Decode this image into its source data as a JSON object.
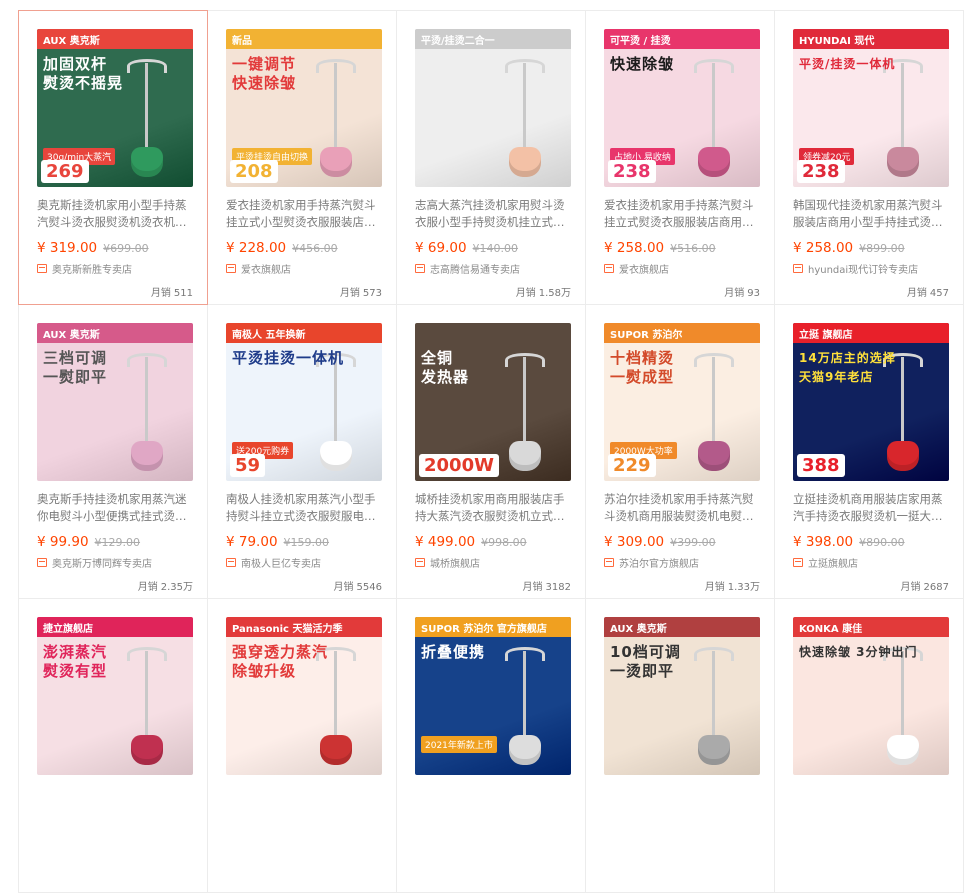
{
  "products": [
    {
      "image": {
        "banner": "AUX 奥克斯",
        "headline": "加固双杆\n熨烫不摇晃",
        "tag": "30g/min大蒸汽",
        "price_tag": "269",
        "bg": "#2f6b4f",
        "fg": "#ffffff",
        "accent": "#e8453c",
        "tank": "#2f9a5e"
      },
      "title": "奥克斯挂烫机家用小型手持蒸汽熨斗烫衣服熨烫机烫衣机电…",
      "price": "¥ 319.00",
      "original_price": "¥699.00",
      "shop": "奥克斯新胜专卖店",
      "sales_label": "月销",
      "sales": "511"
    },
    {
      "image": {
        "banner": "新品",
        "headline": "一键调节\n快速除皱",
        "tag": "平烫挂烫自由切换",
        "price_tag": "208",
        "bg": "#f4e3d6",
        "fg": "#e23a3a",
        "accent": "#f2b233",
        "tank": "#e9a0b8"
      },
      "title": "爱衣挂烫机家用手持蒸汽熨斗挂立式小型熨烫衣服服装店商…",
      "price": "¥ 228.00",
      "original_price": "¥456.00",
      "shop": "爱衣旗舰店",
      "sales_label": "月销",
      "sales": "573"
    },
    {
      "image": {
        "banner": "平烫/挂烫二合一",
        "headline": "",
        "tag": "",
        "price_tag": "",
        "bg": "#eeeeee",
        "fg": "#333333",
        "accent": "#cccccc",
        "tank": "#f3c1a6"
      },
      "title": "志高大蒸汽挂烫机家用熨斗烫衣服小型手持熨烫机挂立式电…",
      "price": "¥ 69.00",
      "original_price": "¥140.00",
      "shop": "志高腾信易通专卖店",
      "sales_label": "月销",
      "sales": "1.58万"
    },
    {
      "image": {
        "banner": "可平烫 / 挂烫",
        "headline": "快速除皱",
        "tag": "占地小 易收纳",
        "price_tag": "238",
        "bg": "#f6d9e2",
        "fg": "#1c1c1c",
        "accent": "#e8356b",
        "tank": "#d05a8c"
      },
      "title": "爱衣挂烫机家用手持蒸汽熨斗挂立式熨烫衣服服装店商用…",
      "price": "¥ 258.00",
      "original_price": "¥516.00",
      "shop": "爱衣旗舰店",
      "sales_label": "月销",
      "sales": "93"
    },
    {
      "image": {
        "banner": "HYUNDAI 现代",
        "headline": "平烫/挂烫一体机",
        "tag": "领券减20元",
        "price_tag": "238",
        "bg": "#fbe8ec",
        "fg": "#e02a3a",
        "accent": "#e02a3a",
        "tank": "#c9899d"
      },
      "title": "韩国现代挂烫机家用蒸汽熨斗服装店商用小型手持挂式烫衣…",
      "price": "¥ 258.00",
      "original_price": "¥899.00",
      "shop": "hyundai现代订铃专卖店",
      "sales_label": "月销",
      "sales": "457"
    },
    {
      "image": {
        "banner": "AUX 奥克斯",
        "headline": "三档可调\n一熨即平",
        "tag": "",
        "price_tag": "",
        "bg": "#f1d3df",
        "fg": "#555555",
        "accent": "#d65a8a",
        "tank": "#e0a7c5"
      },
      "title": "奥克斯手持挂烫机家用蒸汽迷你电熨斗小型便携式挂式烫衣…",
      "price": "¥ 99.90",
      "original_price": "¥129.00",
      "shop": "奥克斯万博同辉专卖店",
      "sales_label": "月销",
      "sales": "2.35万"
    },
    {
      "image": {
        "banner": "南极人 五年换新",
        "headline": "平烫挂烫一体机",
        "tag": "送200元购券",
        "price_tag": "59",
        "bg": "#eef4fb",
        "fg": "#1f3c8a",
        "accent": "#e8452c",
        "tank": "#ffffff"
      },
      "title": "南极人挂烫机家用蒸汽小型手持熨斗挂立式烫衣服熨服电…",
      "price": "¥ 79.00",
      "original_price": "¥159.00",
      "shop": "南极人巨亿专卖店",
      "sales_label": "月销",
      "sales": "5546"
    },
    {
      "image": {
        "banner": "",
        "headline": "全铜\n发热器",
        "tag": "",
        "price_tag": "2000W",
        "bg": "#5a4a3e",
        "fg": "#ffffff",
        "accent": "#e23a2a",
        "tank": "#d9d9d9"
      },
      "title": "城桥挂烫机家用商用服装店手持大蒸汽烫衣服熨烫机立式大…",
      "price": "¥ 499.00",
      "original_price": "¥998.00",
      "shop": "城桥旗舰店",
      "sales_label": "月销",
      "sales": "3182"
    },
    {
      "image": {
        "banner": "SUPOR 苏泊尔",
        "headline": "十档精烫\n一熨成型",
        "tag": "2000W大功率",
        "price_tag": "229",
        "bg": "#fbeee2",
        "fg": "#d34a2a",
        "accent": "#f08a2a",
        "tank": "#b35a8a"
      },
      "title": "苏泊尔挂烫机家用手持蒸汽熨斗烫机商用服装熨烫机电熨斗…",
      "price": "¥ 309.00",
      "original_price": "¥399.00",
      "shop": "苏泊尔官方旗舰店",
      "sales_label": "月销",
      "sales": "1.33万"
    },
    {
      "image": {
        "banner": "立挺 旗舰店",
        "headline": "14万店主的选择\n天猫9年老店",
        "tag": "",
        "price_tag": "388",
        "bg": "#10215e",
        "fg": "#ffe03a",
        "accent": "#e8202a",
        "tank": "#d8262c"
      },
      "title": "立挺挂烫机商用服装店家用蒸汽手持烫衣服熨烫机一挺大功…",
      "price": "¥ 398.00",
      "original_price": "¥890.00",
      "shop": "立挺旗舰店",
      "sales_label": "月销",
      "sales": "2687"
    },
    {
      "image": {
        "banner": "捷立旗舰店",
        "headline": "澎湃蒸汽\n熨烫有型",
        "tag": "",
        "price_tag": "",
        "bg": "#f6dfe4",
        "fg": "#e0245a",
        "accent": "#e0245a",
        "tank": "#c03050"
      },
      "title": "",
      "price": "",
      "original_price": "",
      "shop": "",
      "sales_label": "",
      "sales": ""
    },
    {
      "image": {
        "banner": "Panasonic 天猫活力季",
        "headline": "强穿透力蒸汽\n除皱升级",
        "tag": "",
        "price_tag": "",
        "bg": "#fdeee9",
        "fg": "#e23a3a",
        "accent": "#e23a3a",
        "tank": "#c33"
      },
      "title": "",
      "price": "",
      "original_price": "",
      "shop": "",
      "sales_label": "",
      "sales": ""
    },
    {
      "image": {
        "banner": "SUPOR 苏泊尔 官方旗舰店",
        "headline": "折叠便携",
        "tag": "2021年新款上市",
        "price_tag": "",
        "bg": "#16428a",
        "fg": "#ffffff",
        "accent": "#f0a020",
        "tank": "#ddd"
      },
      "title": "",
      "price": "",
      "original_price": "",
      "shop": "",
      "sales_label": "",
      "sales": ""
    },
    {
      "image": {
        "banner": "AUX 奥克斯",
        "headline": "10档可调\n一烫即平",
        "tag": "",
        "price_tag": "",
        "bg": "#f1e3d4",
        "fg": "#333333",
        "accent": "#b04040",
        "tank": "#aaa"
      },
      "title": "",
      "price": "",
      "original_price": "",
      "shop": "",
      "sales_label": "",
      "sales": ""
    },
    {
      "image": {
        "banner": "KONKA 康佳",
        "headline": "快速除皱 3分钟出门",
        "tag": "",
        "price_tag": "",
        "bg": "#fbe6e0",
        "fg": "#333333",
        "accent": "#e23a3a",
        "tank": "#fff"
      },
      "title": "",
      "price": "",
      "original_price": "",
      "shop": "",
      "sales_label": "",
      "sales": ""
    }
  ]
}
